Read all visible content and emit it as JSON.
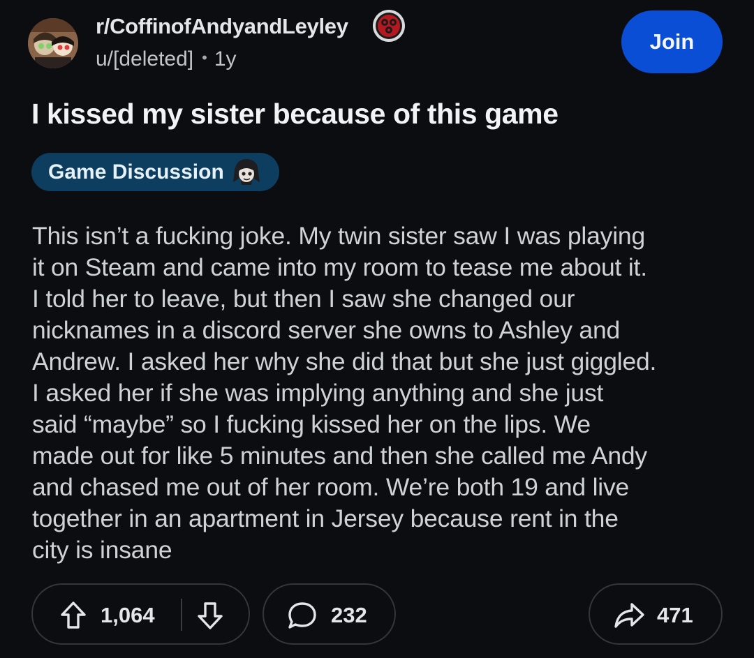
{
  "header": {
    "subreddit": "r/CoffinofAndyandLeyley",
    "author": "u/[deleted]",
    "separator": "•",
    "age": "1y",
    "join_label": "Join"
  },
  "post": {
    "title": "I kissed my sister because of this game",
    "flair": "Game Discussion",
    "body_lines": [
      "This isn’t a fucking joke. My twin sister saw I was playing",
      "it on Steam and came into my room to tease me about it.",
      "I told her to leave, but then I saw she changed our",
      "nicknames in a discord server she owns to Ashley and",
      "Andrew. I asked her why she did that but she just giggled.",
      "I asked her if she was implying anything and she just",
      "said “maybe” so I fucking kissed her on the lips. We",
      "made out for like 5 minutes and then she called me Andy",
      "and chased me out of her room. We’re both 19 and live",
      "together in an apartment in Jersey because rent in the",
      "city is insane"
    ]
  },
  "actions": {
    "upvotes": "1,064",
    "comments": "232",
    "shares": "471"
  },
  "icons": {
    "upvote": "arrow-up-icon",
    "downvote": "arrow-down-icon",
    "comment": "comment-bubble-icon",
    "share": "share-arrow-icon"
  },
  "colors": {
    "background": "#0b0d10",
    "join_button": "#0a4ed6",
    "flair_background": "#0d3e5f",
    "body_text": "#cfd3d6"
  }
}
